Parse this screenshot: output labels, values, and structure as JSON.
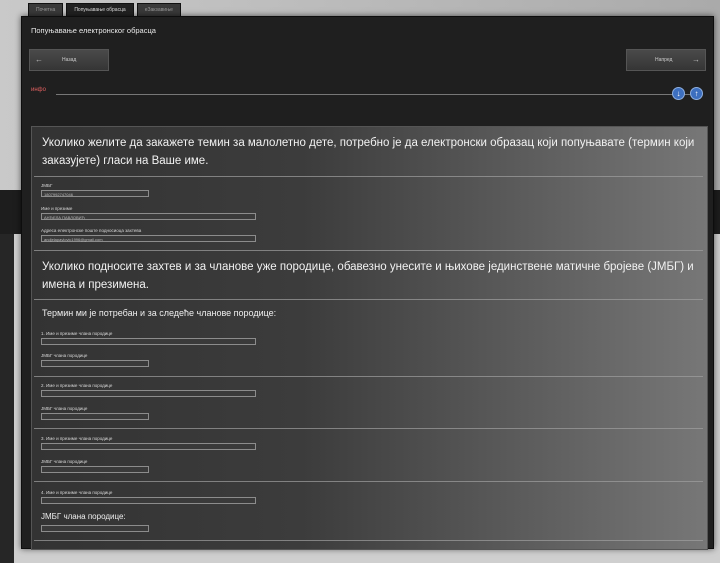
{
  "tabs": [
    "Почетна",
    "Попуњавање обрасца",
    "eЗакзавиње"
  ],
  "dialog": {
    "title": "Попуњавање електронског обрасца",
    "prev_label": "Назад",
    "next_label": "Напред",
    "info_label": "инфо"
  },
  "intro": "Уколико желите да закажете темин за малолетно дете, потребно је да електронски образац који попуњавате (термин који заказујете) гласи на Ваше име.",
  "applicant": {
    "jmbg_label": "JMБГ",
    "jmbg_value": "1807992747046",
    "name_label": "Име и презиме",
    "name_value": "АНЂЕЛА ПАВЛОВИЋ",
    "email_label": "Адреса електронске поште подносиоца захтева",
    "email_value": "andjelapavlovic1996@gmail.com"
  },
  "family_notice": "Уколико подносите захтев и за чланове уже породице, обавезно унесите и њихове јединствене матичне бројеве (ЈМБГ) и имена и презимена.",
  "family_heading": "Термин ми је потребан и за следеће чланове породице:",
  "members": [
    {
      "name_label": "1. Име и презиме члана породице",
      "jmbg_label": "ЈМБГ члана породице"
    },
    {
      "name_label": "2. Име и презиме члана породице",
      "jmbg_label": "ЈМБГ члана породице"
    },
    {
      "name_label": "3. Име и презиме члана породице",
      "jmbg_label": "ЈМБГ члана породице"
    },
    {
      "name_label": "4. Име и презиме члана породице",
      "jmbg_label": "ЈМБГ члана породице:"
    }
  ]
}
